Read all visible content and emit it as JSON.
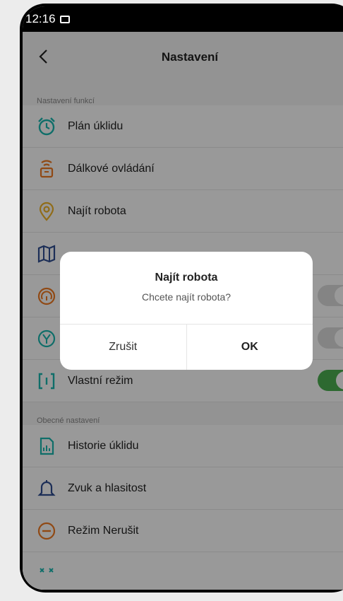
{
  "status": {
    "time": "12:16"
  },
  "navbar": {
    "title": "Nastavení"
  },
  "sections": {
    "functions_header": "Nastavení funkcí",
    "general_header": "Obecné nastavení"
  },
  "rows": {
    "plan": "Plán úklidu",
    "remote": "Dálkové ovládání",
    "find": "Najít robota",
    "custom": "Vlastní režim",
    "history": "Historie úklidu",
    "sound": "Zvuk a hlasitost",
    "dnd": "Režim Nerušit"
  },
  "dialog": {
    "title": "Najít robota",
    "message": "Chcete najít robota?",
    "cancel": "Zrušit",
    "ok": "OK"
  },
  "colors": {
    "accent_green": "#4caf50",
    "icon_teal": "#19b7b0",
    "icon_orange": "#f07b22",
    "icon_yellow": "#f0b428",
    "icon_navy": "#2f4d91"
  }
}
